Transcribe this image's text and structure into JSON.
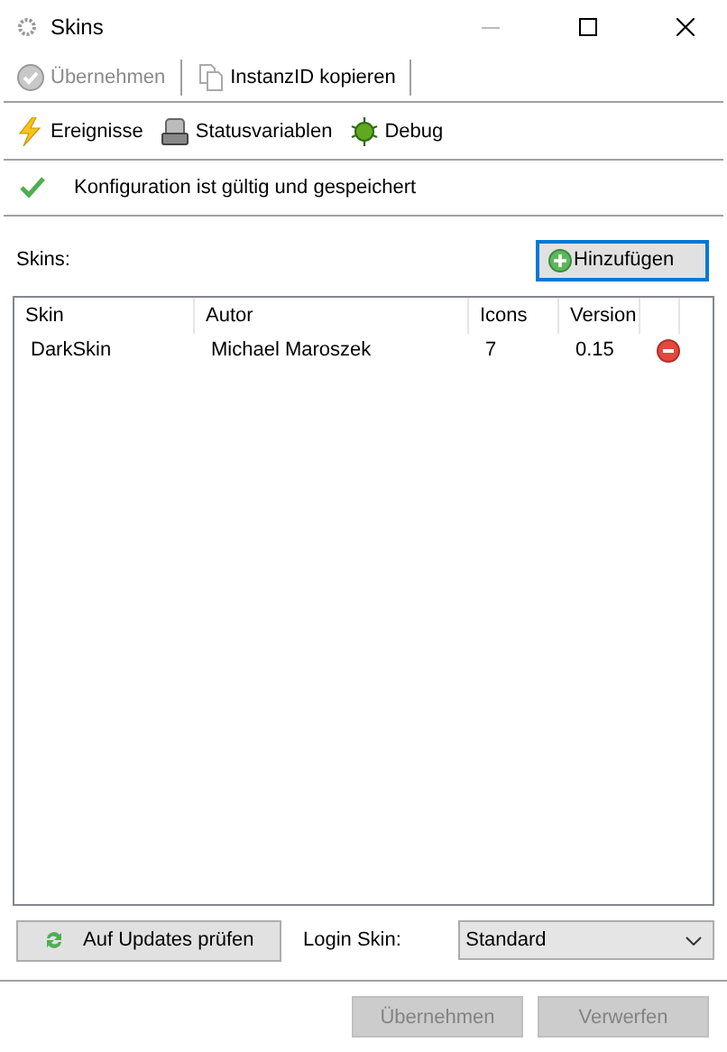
{
  "window": {
    "title": "Skins"
  },
  "toolbar": [
    {
      "label": "Übernehmen",
      "kind": "apply",
      "disabled": true
    },
    {
      "label": "InstanzID kopieren",
      "kind": "copy",
      "disabled": false
    }
  ],
  "navbar": [
    {
      "label": "Ereignisse",
      "kind": "events"
    },
    {
      "label": "Statusvariablen",
      "kind": "variables"
    },
    {
      "label": "Debug",
      "kind": "debug"
    }
  ],
  "status": {
    "message": "Konfiguration ist gültig und gespeichert"
  },
  "skins_label": "Skins:",
  "add_button": "Hinzufügen",
  "table": {
    "columns": [
      "Skin",
      "Autor",
      "Icons",
      "Version"
    ],
    "rows": [
      {
        "cells": [
          "DarkSkin",
          "Michael Maroszek",
          "7",
          "0.15"
        ]
      }
    ]
  },
  "update_button": "Auf Updates prüfen",
  "login_skin": {
    "label": "Login Skin:",
    "value": "Standard"
  },
  "footer_buttons": [
    {
      "label": "Übernehmen",
      "disabled": true
    },
    {
      "label": "Verwerfen",
      "disabled": true
    }
  ]
}
